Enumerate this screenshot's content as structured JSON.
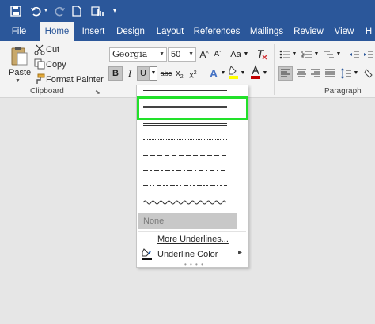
{
  "colors": {
    "accent": "#2b579a",
    "highlight": "#22e12a",
    "font_color_swatch": "#c00000",
    "highlight_swatch": "#ffff00"
  },
  "quick_access": {
    "save_icon": "save-icon",
    "undo_icon": "undo-icon",
    "redo_icon": "redo-icon",
    "new_icon": "new-document-icon",
    "touch_icon": "touch-mode-icon",
    "customize_icon": "customize-dropdown-icon"
  },
  "ribbon_tabs": [
    "File",
    "Home",
    "Insert",
    "Design",
    "Layout",
    "References",
    "Mailings",
    "Review",
    "View",
    "H"
  ],
  "active_tab": "Home",
  "clipboard": {
    "paste_label": "Paste",
    "cut_label": "Cut",
    "copy_label": "Copy",
    "format_painter_label": "Format Painter",
    "group_label": "Clipboard"
  },
  "font": {
    "font_name": "Georgia",
    "font_size": "50",
    "grow_label": "A",
    "shrink_label": "A",
    "change_case_label": "Aa",
    "bold_label": "B",
    "italic_label": "I",
    "underline_label": "U",
    "strike_label": "abc",
    "subscript_label": "x",
    "superscript_label": "x",
    "subscript_mark": "2",
    "superscript_mark": "2"
  },
  "paragraph": {
    "group_label": "Paragraph"
  },
  "underline_menu": {
    "styles": [
      "single",
      "thick",
      "double",
      "dotted",
      "dashed",
      "dash-dot",
      "dash-dot-dot",
      "wave"
    ],
    "selected_style": "thick",
    "none_label": "None",
    "more_label": "More Underlines...",
    "color_label": "Underline Color",
    "submenu_arrow": "▸"
  }
}
